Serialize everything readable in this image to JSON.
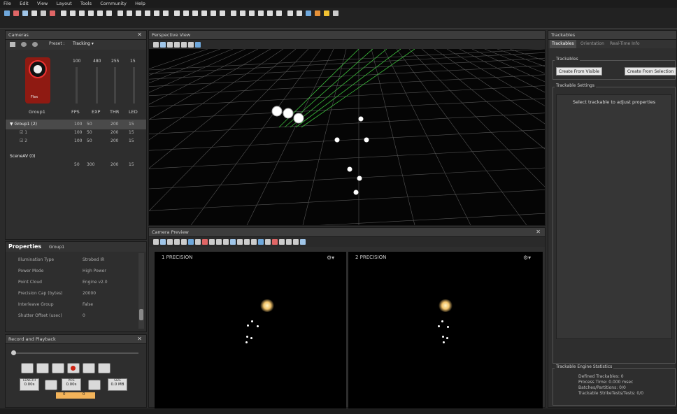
{
  "menu": [
    "File",
    "Edit",
    "View",
    "Layout",
    "Tools",
    "Community",
    "Help"
  ],
  "cameras": {
    "title": "Cameras",
    "preset_label": "Preset :",
    "preset_value": "Tracking ▾",
    "slider_values": [
      "100",
      "480",
      "255",
      "15"
    ],
    "slider_labels": [
      "FPS",
      "EXP",
      "THR",
      "LED"
    ],
    "group_label": "Group1",
    "device_badge": "Flex",
    "tree": [
      {
        "label": "▼ Group1 (2)",
        "vals": [
          "100",
          "50",
          "200",
          "15"
        ]
      },
      {
        "label": "☑ 1",
        "vals": [
          "100",
          "50",
          "200",
          "15"
        ]
      },
      {
        "label": "☑ 2",
        "vals": [
          "100",
          "50",
          "200",
          "15"
        ]
      },
      {
        "label": "SceneAV (0)",
        "vals": []
      },
      {
        "label": "",
        "vals": [
          "50",
          "300",
          "200",
          "15"
        ]
      }
    ]
  },
  "properties": {
    "title": "Properties",
    "subtitle": "Group1",
    "rows": [
      {
        "key": "Illumination Type",
        "value": "Strobed IR"
      },
      {
        "key": "Power Mode",
        "value": "High Power"
      },
      {
        "key": "Point Cloud",
        "value": "Engine v2.0"
      },
      {
        "key": "Precision Cap (bytes)",
        "value": "20000"
      },
      {
        "key": "Interleave Group",
        "value": "False"
      },
      {
        "key": "Shutter Offset (usec)",
        "value": "0"
      }
    ]
  },
  "record": {
    "title": "Record and Playback",
    "length_label": "LENGTH",
    "length_value": "0.00s",
    "pos_label": "POS",
    "pos_value": "0.00s",
    "size_label": "SIZE",
    "size_value": "0.0 MB",
    "frame_start": "0",
    "frame_end": "0"
  },
  "perspective": {
    "title": "Perspective View"
  },
  "preview": {
    "title": "Camera Preview",
    "cam1_label": "1  PRECISION",
    "cam2_label": "2  PRECISION"
  },
  "trackables": {
    "title": "Trackables",
    "tabs": [
      "Trackables",
      "Orientation",
      "Real-Time Info"
    ],
    "group_trackables": "Trackables",
    "create_visible": "Create From Visible",
    "create_selection": "Create From Selection",
    "settings_title": "Trackable Settings",
    "settings_hint": "Select trackable to adjust properties",
    "stats_title": "Trackable Engine Statistics",
    "stats": [
      "Defined Trackables: 0",
      "Process Time: 0.000 msec",
      "Batches/Partitions: 0/0",
      "Trackable StrikeTests/Tests: 0/0"
    ]
  },
  "colors": {
    "accent": "#e05a1e",
    "highlight": "#f2c36b",
    "grid": "#555555",
    "ray": "#3cbf3c"
  }
}
